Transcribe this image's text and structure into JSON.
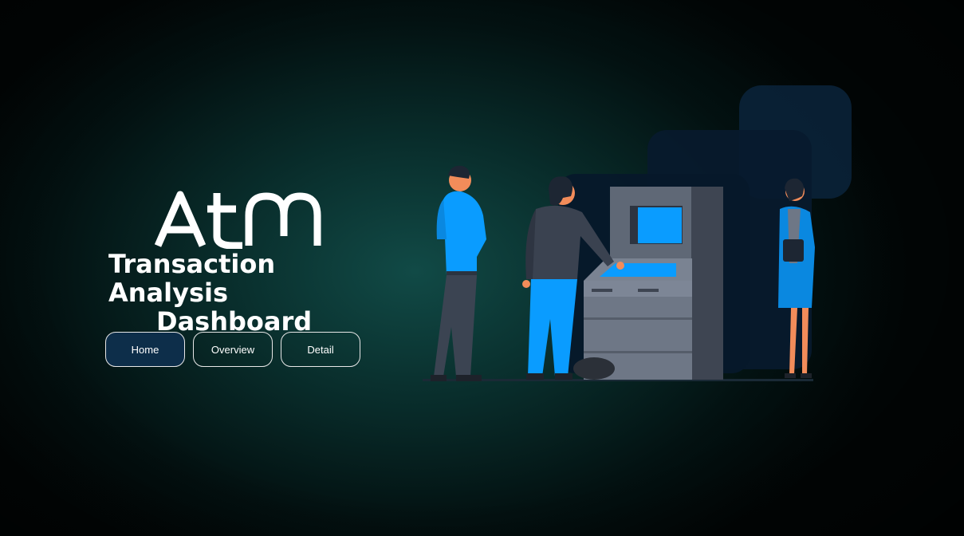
{
  "brand": {
    "logo_text": "ATM"
  },
  "title": {
    "line1": "Transaction Analysis",
    "line2": "Dashboard"
  },
  "nav": {
    "items": [
      {
        "label": "Home",
        "active": true
      },
      {
        "label": "Overview",
        "active": false
      },
      {
        "label": "Detail",
        "active": false
      }
    ]
  },
  "colors": {
    "background": "#0c3f3c",
    "accent_blue": "#0a9cff",
    "active_button": "#0d2e4a",
    "atm_body": "#6b7380"
  },
  "icons": [
    "atm-logo-icon",
    "atm-illustration-icon"
  ]
}
